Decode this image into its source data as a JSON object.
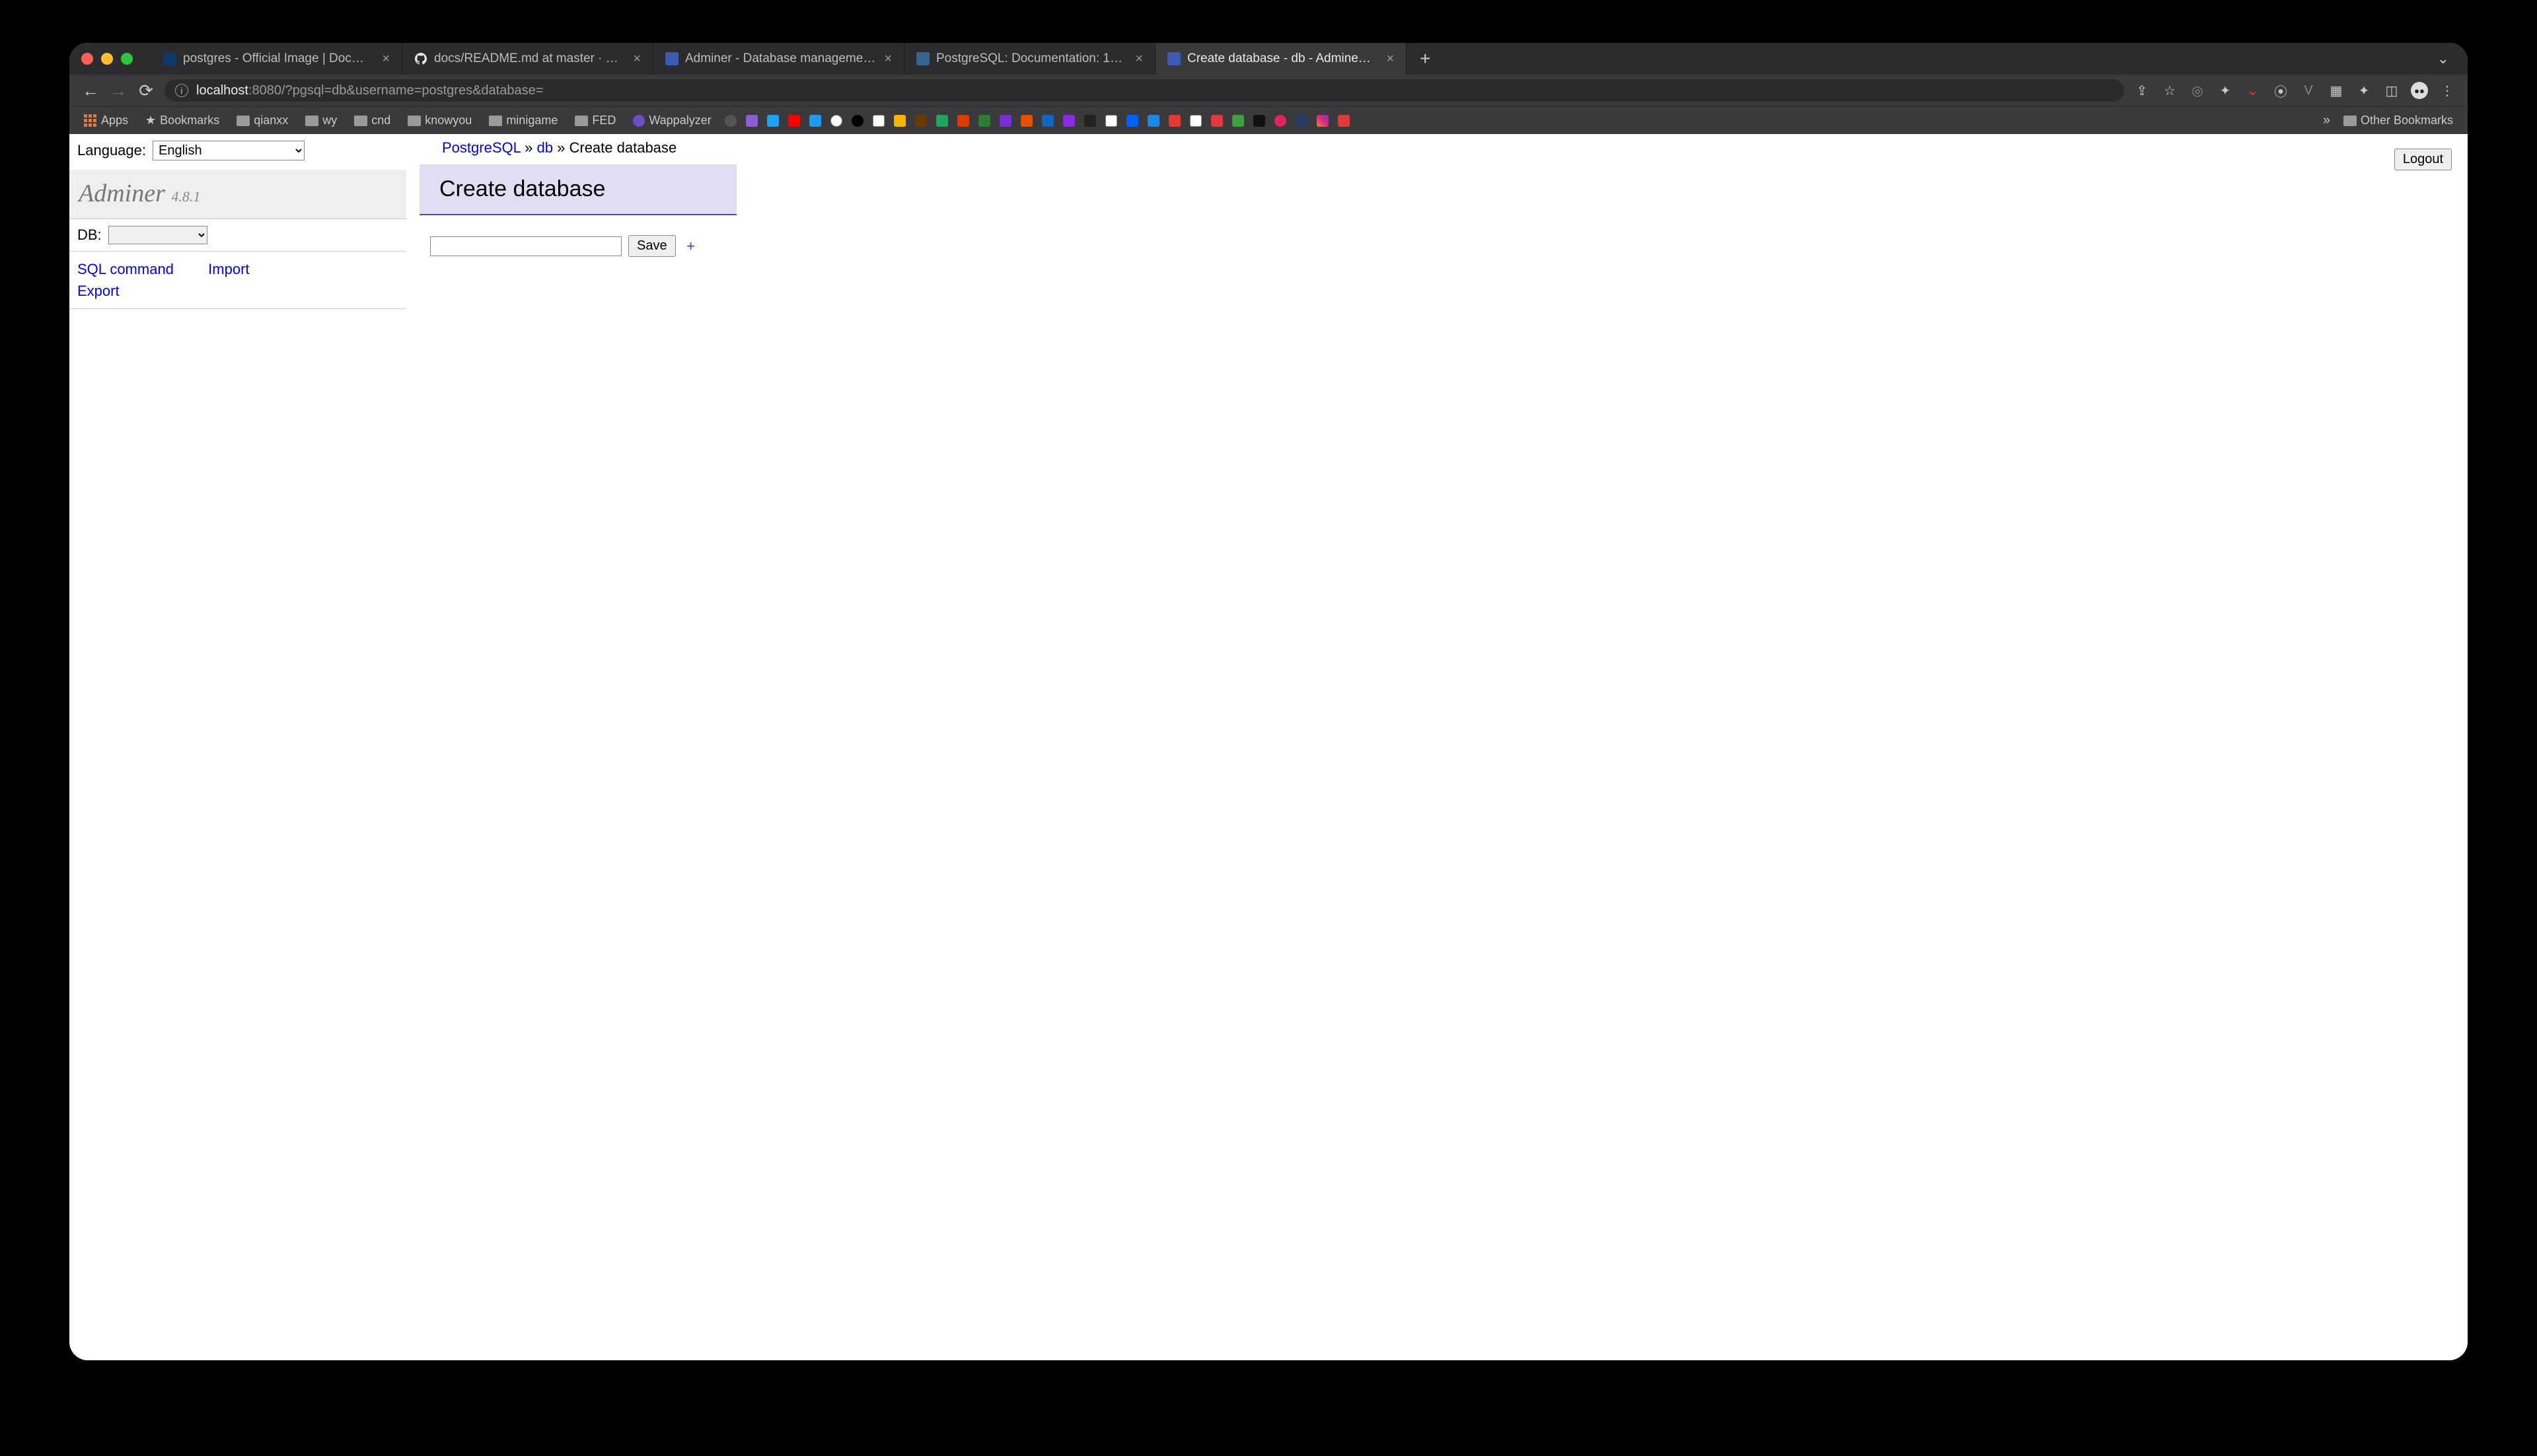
{
  "browser": {
    "tabs": [
      {
        "title": "postgres - Official Image | Doc…",
        "active": false,
        "favicon": "#1f5fa8"
      },
      {
        "title": "docs/README.md at master · …",
        "active": false,
        "favicon": "#ffffff",
        "icon": "github"
      },
      {
        "title": "Adminer - Database manageme…",
        "active": false,
        "favicon": "#3b5bb5"
      },
      {
        "title": "PostgreSQL: Documentation: 1…",
        "active": false,
        "favicon": "#336791"
      },
      {
        "title": "Create database - db - Admine…",
        "active": true,
        "favicon": "#3b5bb5"
      }
    ],
    "url_host": "localhost",
    "url_port": ":8080",
    "url_path": "/?pgsql=db&username=postgres&database=",
    "bookmarks_label": "Bookmarks",
    "apps_label": "Apps",
    "other_label": "Other Bookmarks",
    "folders": [
      "qianxx",
      "wy",
      "cnd",
      "knowyou",
      "minigame",
      "FED"
    ],
    "wapp": "Wappalyzer"
  },
  "sidebar": {
    "language_label": "Language:",
    "language_value": "English",
    "brand": "Adminer",
    "version": "4.8.1",
    "db_label": "DB:",
    "db_value": "",
    "links": {
      "sql": "SQL command",
      "import": "Import",
      "export": "Export"
    }
  },
  "breadcrumb": {
    "root": "PostgreSQL",
    "db": "db",
    "current": "Create database"
  },
  "page": {
    "title": "Create database",
    "save": "Save",
    "db_name": ""
  },
  "logout": "Logout"
}
